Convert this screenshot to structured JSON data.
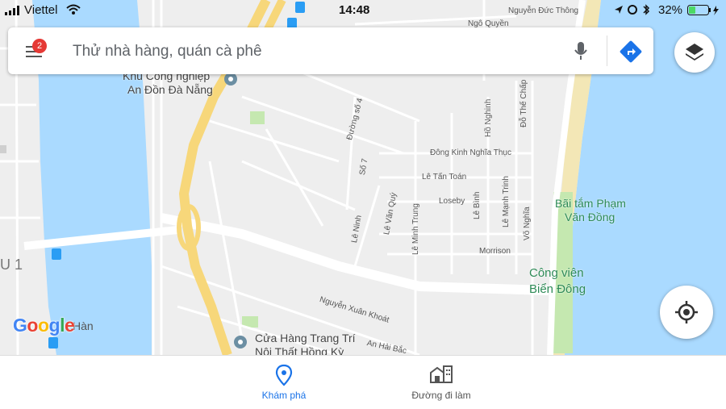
{
  "status_bar": {
    "carrier": "Viettel",
    "time": "14:48",
    "battery": "32%"
  },
  "search": {
    "placeholder": "Thử nhà hàng, quán cà phê",
    "notification_count": "2"
  },
  "map": {
    "labels": {
      "industrial_zone_1": "Khu Công nghiệp",
      "industrial_zone_2": "An Đồn Đà Nẵng",
      "beach_1": "Bãi tắm Phạm",
      "beach_2": "Văn Đồng",
      "park_1": "Công viên",
      "park_2": "Biển Đông",
      "store_1": "Cửa Hàng Trang Trí",
      "store_2": "Nội Thất Hồng Kỳ",
      "han": "Hàn",
      "dong_kinh": "Đông Kinh Nghĩa Thục",
      "le_tan_toan": "Lê Tấn Toán",
      "loseby": "Loseby",
      "morrison": "Morrison",
      "nguyen_xuan_khoat": "Nguyễn Xuân Khoát",
      "an_hai_bac": "An Hải Bắc",
      "ho_nghinh": "Hồ Nghinh",
      "le_binh": "Lê Bình",
      "le_manh_trinh": "Lê Mạnh Trinh",
      "vo_nghia": "Võ Nghĩa",
      "duong_so_4": "Đường số 4",
      "so_7": "Số 7",
      "le_van_quy": "Lê Văn Quý",
      "le_ninh": "Lê Ninh",
      "le_minh_trung": "Lê Minh Trung",
      "nguyen_duc_thong": "Nguyễn Đức Thông",
      "ngo_quyen": "Ngô Quyền",
      "do_the_chap": "Đỗ Thế Chấp",
      "district_u1": "U 1"
    },
    "logo": "Google"
  },
  "nav": {
    "explore": "Khám phá",
    "commute": "Đường đi làm"
  },
  "colors": {
    "water": "#aadaff",
    "land": "#eeeeee",
    "highway": "#f7d77a",
    "park": "#c5e8b0",
    "beach": "#f3e7b6",
    "accent": "#1a73e8"
  }
}
